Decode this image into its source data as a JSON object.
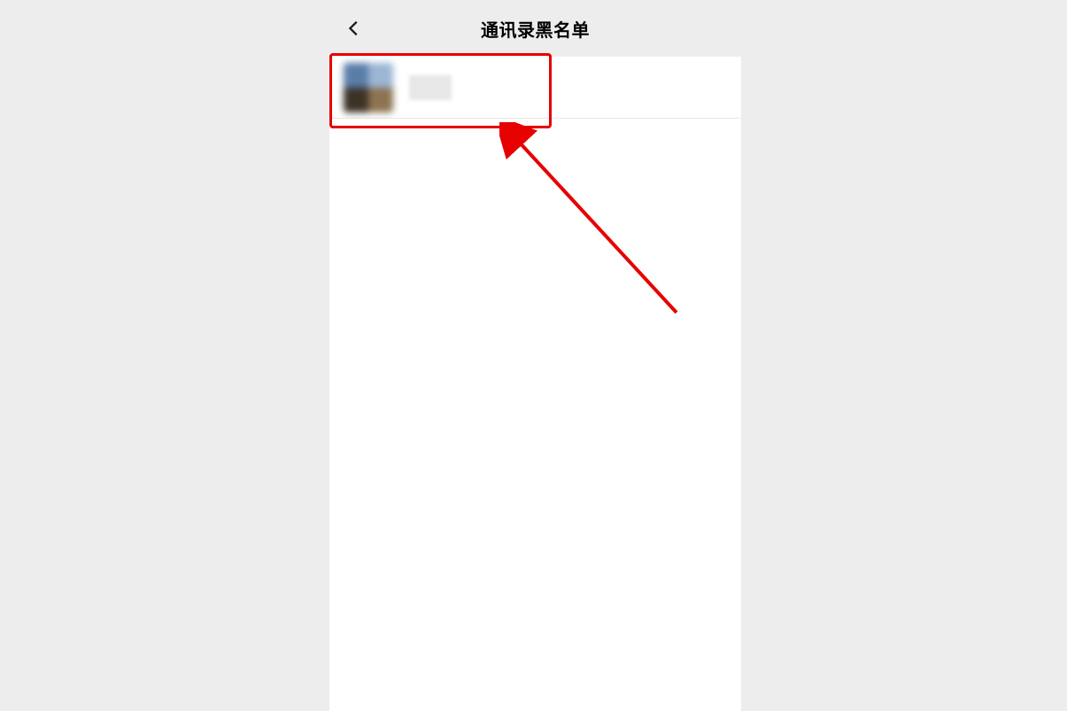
{
  "header": {
    "back_icon_name": "back-icon",
    "title": "通讯录黑名单"
  },
  "contacts": [
    {
      "name_label": "",
      "avatar_alt": "contact-avatar-blurred"
    }
  ],
  "annotation": {
    "highlight_color": "#e60000",
    "arrow_color": "#e60000"
  }
}
